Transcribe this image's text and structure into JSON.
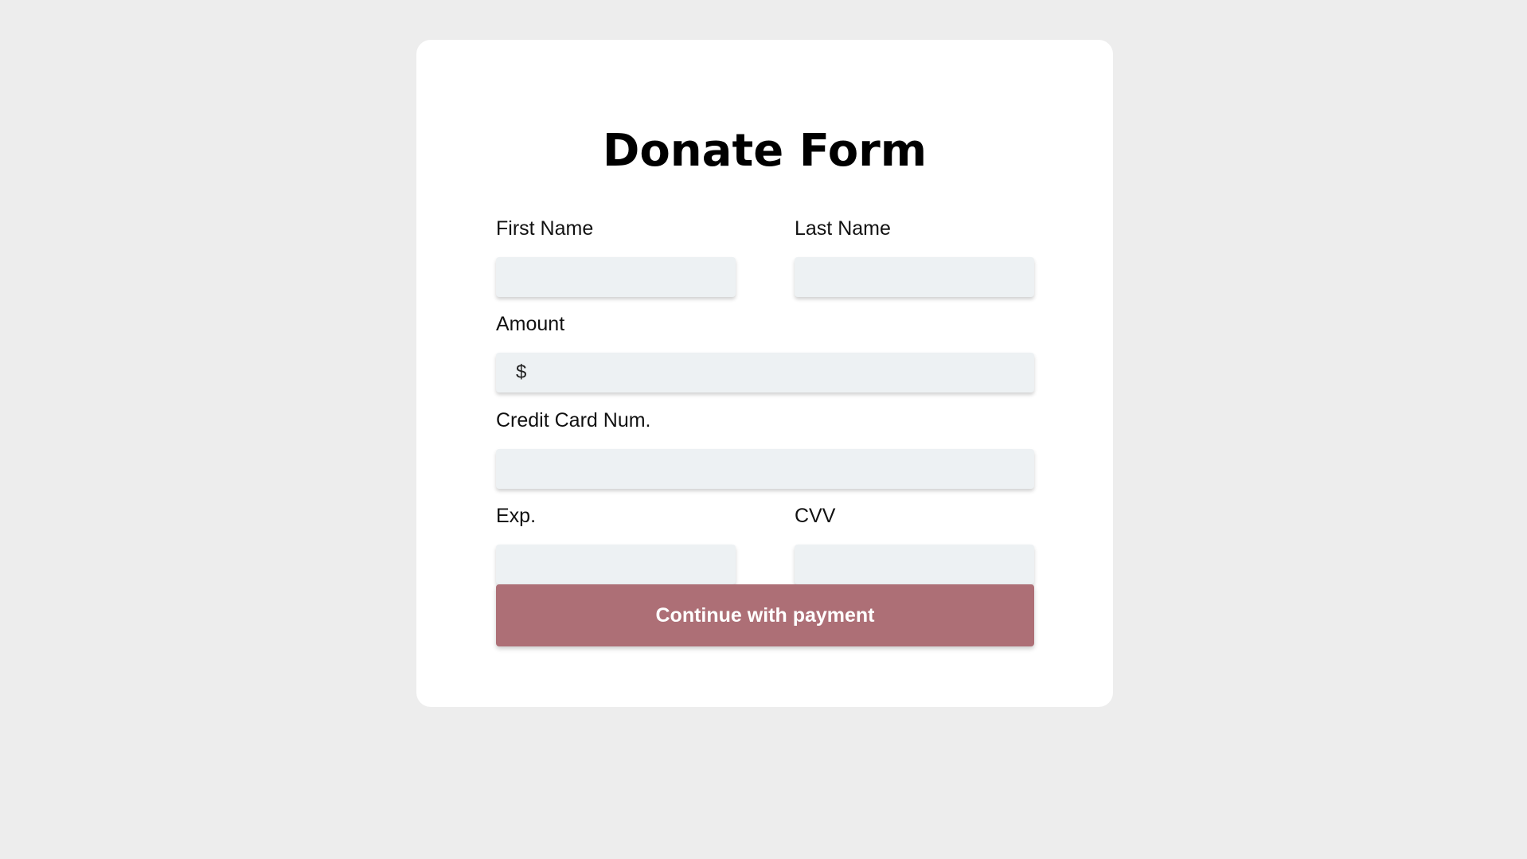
{
  "form": {
    "title": "Donate Form",
    "first_name": {
      "label": "First Name",
      "value": "",
      "placeholder": ""
    },
    "last_name": {
      "label": "Last Name",
      "value": "",
      "placeholder": ""
    },
    "amount": {
      "label": "Amount",
      "currency_symbol": "$",
      "value": "",
      "placeholder": ""
    },
    "card_number": {
      "label": "Credit Card Num.",
      "value": "",
      "placeholder": ""
    },
    "expiry": {
      "label": "Exp.",
      "value": "",
      "placeholder": ""
    },
    "cvv": {
      "label": "CVV",
      "value": "",
      "placeholder": ""
    },
    "submit_label": "Continue with payment"
  },
  "colors": {
    "background": "#ededed",
    "card": "#ffffff",
    "input_fill": "#edf1f3",
    "button": "#ad6f76",
    "button_text": "#ffffff"
  }
}
